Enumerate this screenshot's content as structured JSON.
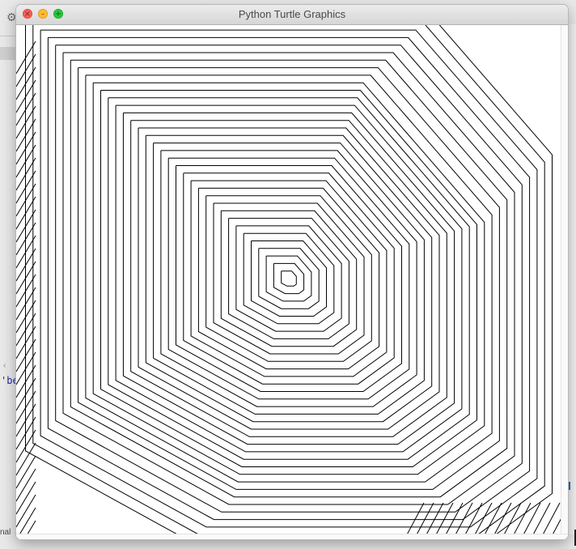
{
  "window": {
    "title": "Python Turtle Graphics",
    "background": "#ffffff",
    "pen_color": "#000000"
  },
  "traffic_lights": {
    "close_color": "#fe5f57",
    "minimize_color": "#febc2e",
    "maximize_color": "#28c840"
  },
  "background_app": {
    "code_fragment": "'be",
    "status_fragment": "nal",
    "gear_icon": "gear-icon"
  },
  "drawing": {
    "pattern": "square spiral with offset diagonal strokes",
    "turns": 35,
    "pen_color": "#000000"
  }
}
